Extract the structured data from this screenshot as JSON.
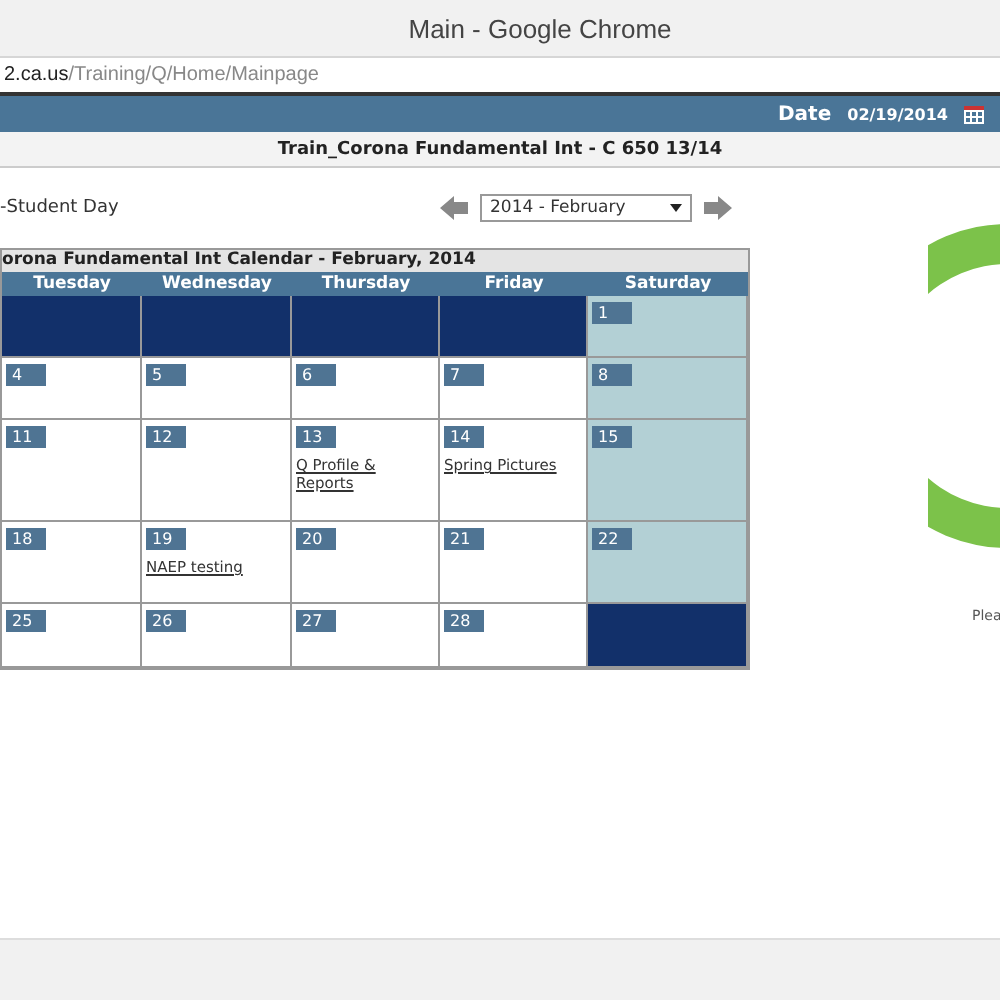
{
  "window": {
    "title": "Main - Google Chrome"
  },
  "address_bar": {
    "host": "2.ca.us",
    "path": "/Training/Q/Home/Mainpage"
  },
  "header": {
    "date_label": "Date",
    "date_value": "02/19/2014"
  },
  "school_title": "Train_Corona Fundamental Int - C 650 13/14",
  "legend_text": "-Student Day",
  "month_select": {
    "value": "2014 - February"
  },
  "calendar": {
    "title": "orona Fundamental Int Calendar  -  February, 2014",
    "columns": [
      "Tuesday",
      "Wednesday",
      "Thursday",
      "Friday",
      "Saturday"
    ],
    "weeks": [
      [
        {
          "kind": "blank"
        },
        {
          "kind": "blank"
        },
        {
          "kind": "blank"
        },
        {
          "kind": "blank"
        },
        {
          "kind": "weekend",
          "day": "1"
        }
      ],
      [
        {
          "kind": "weekday",
          "day": "4"
        },
        {
          "kind": "weekday",
          "day": "5"
        },
        {
          "kind": "weekday",
          "day": "6"
        },
        {
          "kind": "weekday",
          "day": "7"
        },
        {
          "kind": "weekend",
          "day": "8"
        }
      ],
      [
        {
          "kind": "weekday",
          "day": "11"
        },
        {
          "kind": "weekday",
          "day": "12"
        },
        {
          "kind": "weekday",
          "day": "13",
          "event": "Q Profile & Reports"
        },
        {
          "kind": "weekday",
          "day": "14",
          "event": "Spring Pictures"
        },
        {
          "kind": "weekend",
          "day": "15"
        }
      ],
      [
        {
          "kind": "weekday",
          "day": "18"
        },
        {
          "kind": "weekday",
          "day": "19",
          "event": "NAEP testing"
        },
        {
          "kind": "weekday",
          "day": "20"
        },
        {
          "kind": "weekday",
          "day": "21"
        },
        {
          "kind": "weekend",
          "day": "22"
        }
      ],
      [
        {
          "kind": "weekday",
          "day": "25"
        },
        {
          "kind": "weekday",
          "day": "26"
        },
        {
          "kind": "weekday",
          "day": "27"
        },
        {
          "kind": "weekday",
          "day": "28"
        },
        {
          "kind": "blank"
        }
      ]
    ]
  },
  "side_panel": {
    "caption": "Plea"
  }
}
